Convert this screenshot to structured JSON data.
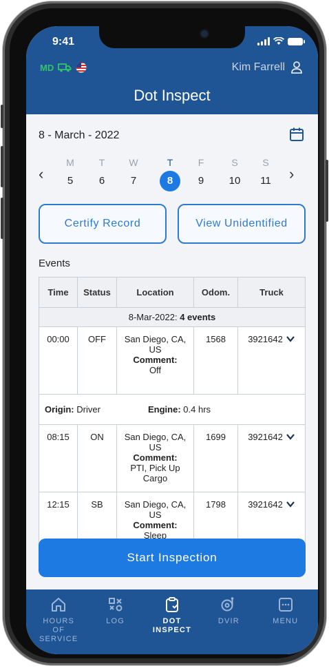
{
  "status_bar": {
    "time": "9:41"
  },
  "header": {
    "md_label": "MD",
    "user_name": "Kim Farrell",
    "title": "Dot Inspect"
  },
  "date": {
    "label": "8 - March - 2022"
  },
  "week": {
    "days": [
      {
        "dow": "M",
        "num": "5"
      },
      {
        "dow": "T",
        "num": "6"
      },
      {
        "dow": "W",
        "num": "7"
      },
      {
        "dow": "T",
        "num": "8",
        "selected": true
      },
      {
        "dow": "F",
        "num": "9"
      },
      {
        "dow": "S",
        "num": "10"
      },
      {
        "dow": "S",
        "num": "11"
      }
    ]
  },
  "actions": {
    "certify_label": "Certify Record",
    "view_unidentified_label": "View Unidentified"
  },
  "events": {
    "label": "Events",
    "columns": [
      "Time",
      "Status",
      "Location",
      "Odom.",
      "Truck"
    ],
    "summary_date": "8-Mar-2022:",
    "summary_count": "4 events",
    "comment_label": "Comment:",
    "rows": [
      {
        "time": "00:00",
        "status": "OFF",
        "location": "San Diego, CA, US",
        "comment": "Off",
        "odom": "1568",
        "truck": "3921642"
      },
      {
        "time": "08:15",
        "status": "ON",
        "location": "San Diego, CA, US",
        "comment": "PTI, Pick Up Cargo",
        "odom": "1699",
        "truck": "3921642"
      },
      {
        "time": "12:15",
        "status": "SB",
        "location": "San Diego, CA, US",
        "comment": "Sleep",
        "odom": "1798",
        "truck": "3921642"
      }
    ],
    "origin_label": "Origin:",
    "origin_value": "Driver",
    "engine_label": "Engine:",
    "engine_value": "0.4 hrs"
  },
  "start_inspection_label": "Start Inspection",
  "tabs": [
    {
      "line1": "HOURS",
      "line2": "OF",
      "line3": "SERVICE",
      "icon": "home-icon"
    },
    {
      "line1": "LOG",
      "line2": "",
      "line3": "",
      "icon": "log-icon"
    },
    {
      "line1": "DOT",
      "line2": "INSPECT",
      "line3": "",
      "icon": "clipboard-icon",
      "active": true
    },
    {
      "line1": "DVIR",
      "line2": "",
      "line3": "",
      "icon": "tape-icon"
    },
    {
      "line1": "MENU",
      "line2": "",
      "line3": "",
      "icon": "menu-icon"
    }
  ],
  "colors": {
    "header_bg": "#1f5594",
    "accent": "#1d7ae2",
    "outline_button": "#2f7ad1",
    "md_green": "#31c46a"
  }
}
